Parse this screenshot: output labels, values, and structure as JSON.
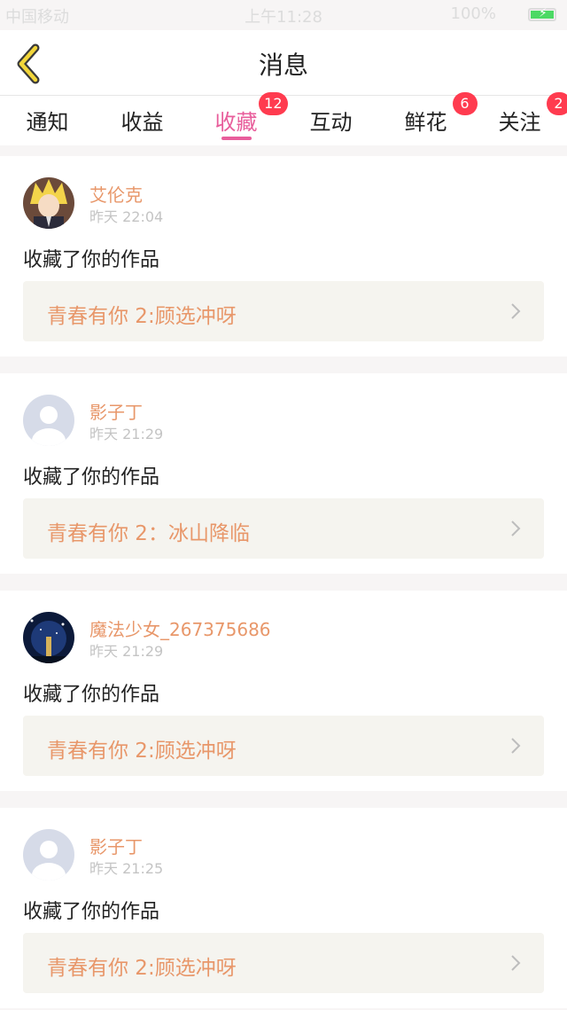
{
  "status_bar": {
    "carrier": "中国移动",
    "time": "上午11:28",
    "battery": "100%"
  },
  "nav": {
    "title": "消息"
  },
  "tabs": [
    {
      "label": "通知",
      "badge": ""
    },
    {
      "label": "收益",
      "badge": ""
    },
    {
      "label": "收藏",
      "badge": "12"
    },
    {
      "label": "互动",
      "badge": ""
    },
    {
      "label": "鲜花",
      "badge": "6"
    },
    {
      "label": "关注",
      "badge": "2"
    }
  ],
  "colors": {
    "accent": "#e85d9b",
    "name": "#e8976a",
    "badge": "#ff3b4f"
  },
  "messages": [
    {
      "name": "艾伦克",
      "time": "昨天 22:04",
      "action": "收藏了你的作品",
      "work": "青春有你 2:顾选冲呀",
      "avatar": "anime-avatar"
    },
    {
      "name": "影子丁",
      "time": "昨天 21:29",
      "action": "收藏了你的作品",
      "work": "青春有你 2：冰山降临",
      "avatar": "default-avatar"
    },
    {
      "name": "魔法少女_267375686",
      "time": "昨天 21:29",
      "action": "收藏了你的作品",
      "work": "青春有你 2:顾选冲呀",
      "avatar": "night-avatar"
    },
    {
      "name": "影子丁",
      "time": "昨天 21:25",
      "action": "收藏了你的作品",
      "work": "青春有你 2:顾选冲呀",
      "avatar": "default-avatar"
    }
  ]
}
